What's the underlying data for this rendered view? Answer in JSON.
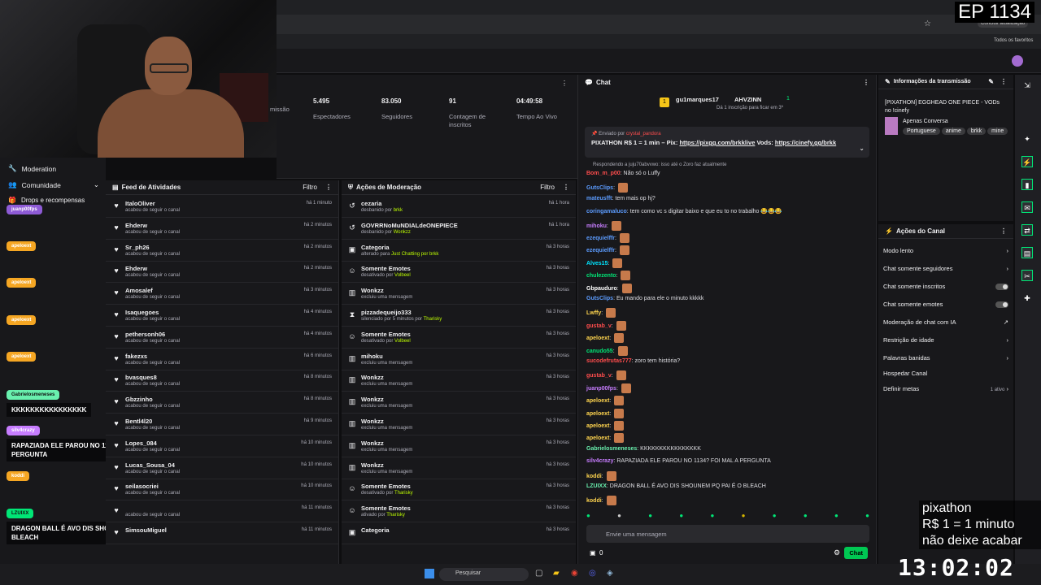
{
  "episode": "EP 1134",
  "browser": {
    "update_button": "Concluir atualização",
    "bookmarks": "Todos os favoritos"
  },
  "stats": [
    {
      "value": "",
      "label": "missão"
    },
    {
      "value": "5.495",
      "label": "Espectadores"
    },
    {
      "value": "83.050",
      "label": "Seguidores"
    },
    {
      "value": "91",
      "label": "Contagem de inscritos"
    },
    {
      "value": "04:49:58",
      "label": "Tempo Ao Vivo"
    }
  ],
  "leftnav": {
    "moderation": "Moderation",
    "community": "Comunidade",
    "drops": "Drops e recompensas"
  },
  "overlay": {
    "users": [
      "juanp00fps",
      "apeloext",
      "apeloext",
      "apeloext",
      "apeloext",
      "Gabrielosmeneses",
      "silv4crazy",
      "koddi",
      "LZUIXX"
    ],
    "msg1": "KKKKKKKKKKKKKKKK",
    "msg2": "RAPAZIADA ELE PAROU NO 1134? FOI MAL A PERGUNTA",
    "msg3": "DRAGON BALL É AVO DIS SHOUNEM PQ PAI É O BLEACH"
  },
  "feed": {
    "title": "Feed de Atividades",
    "filter": "Filtro",
    "items": [
      {
        "name": "ItaloOliver",
        "sub": "acabou de seguir o canal",
        "time": "há 1 minuto"
      },
      {
        "name": "Ehderw",
        "sub": "acabou de seguir o canal",
        "time": "há 2 minutos"
      },
      {
        "name": "Sr_ph26",
        "sub": "acabou de seguir o canal",
        "time": "há 2 minutos"
      },
      {
        "name": "Ehderw",
        "sub": "acabou de seguir o canal",
        "time": "há 2 minutos"
      },
      {
        "name": "Amosalef",
        "sub": "acabou de seguir o canal",
        "time": "há 3 minutos"
      },
      {
        "name": "Isaquegoes",
        "sub": "acabou de seguir o canal",
        "time": "há 4 minutos"
      },
      {
        "name": "pethersonh06",
        "sub": "acabou de seguir o canal",
        "time": "há 4 minutos"
      },
      {
        "name": "fakezxs",
        "sub": "acabou de seguir o canal",
        "time": "há 6 minutos"
      },
      {
        "name": "bvasques8",
        "sub": "acabou de seguir o canal",
        "time": "há 8 minutos"
      },
      {
        "name": "Gbzzinho",
        "sub": "acabou de seguir o canal",
        "time": "há 8 minutos"
      },
      {
        "name": "Bentl4l20",
        "sub": "acabou de seguir o canal",
        "time": "há 9 minutos"
      },
      {
        "name": "Lopes_084",
        "sub": "acabou de seguir o canal",
        "time": "há 10 minutos"
      },
      {
        "name": "Lucas_Sousa_04",
        "sub": "acabou de seguir o canal",
        "time": "há 10 minutos"
      },
      {
        "name": "seilasocriei",
        "sub": "acabou de seguir o canal",
        "time": "há 10 minutos"
      },
      {
        "name": "",
        "sub": "acabou de seguir o canal",
        "time": "há 11 minutos"
      },
      {
        "name": "SimsouMiguel",
        "sub": "",
        "time": "há 11 minutos"
      }
    ]
  },
  "mod": {
    "title": "Ações de Moderação",
    "filter": "Filtro",
    "items": [
      {
        "icon": "↺",
        "name": "cezaria",
        "pre": "desbanido por",
        "by": "brkk",
        "time": "há 1 hora"
      },
      {
        "icon": "↺",
        "name": "GOVRRNoMuNDIALdeONEPIECE",
        "pre": "desbanido por",
        "by": "Wonkzz",
        "time": "há 1 hora"
      },
      {
        "icon": "▣",
        "name": "Categoria",
        "pre": "alterado para",
        "by": "Just Chatting por brkk",
        "time": "há 3 horas"
      },
      {
        "icon": "☺",
        "name": "Somente Emotes",
        "pre": "desativado por",
        "by": "Volbeel",
        "time": "há 3 horas"
      },
      {
        "icon": "▥",
        "name": "Wonkzz",
        "pre": "excluiu uma mensagem",
        "by": "",
        "time": "há 3 horas"
      },
      {
        "icon": "⧗",
        "name": "pizzadequeijo333",
        "pre": "silenciado por 5 minutos por",
        "by": "Tharisky",
        "time": "há 3 horas"
      },
      {
        "icon": "☺",
        "name": "Somente Emotes",
        "pre": "desativado por",
        "by": "Volbeel",
        "time": "há 3 horas"
      },
      {
        "icon": "▥",
        "name": "mihoku",
        "pre": "excluiu uma mensagem",
        "by": "",
        "time": "há 3 horas"
      },
      {
        "icon": "▥",
        "name": "Wonkzz",
        "pre": "excluiu uma mensagem",
        "by": "",
        "time": "há 3 horas"
      },
      {
        "icon": "▥",
        "name": "Wonkzz",
        "pre": "excluiu uma mensagem",
        "by": "",
        "time": "há 3 horas"
      },
      {
        "icon": "▥",
        "name": "Wonkzz",
        "pre": "excluiu uma mensagem",
        "by": "",
        "time": "há 3 horas"
      },
      {
        "icon": "▥",
        "name": "Wonkzz",
        "pre": "excluiu uma mensagem",
        "by": "",
        "time": "há 3 horas"
      },
      {
        "icon": "▥",
        "name": "Wonkzz",
        "pre": "excluiu uma mensagem",
        "by": "",
        "time": "há 3 horas"
      },
      {
        "icon": "☺",
        "name": "Somente Emotes",
        "pre": "desativado por",
        "by": "Tharisky",
        "time": "há 3 horas"
      },
      {
        "icon": "☺",
        "name": "Somente Emotes",
        "pre": "ativado por",
        "by": "Tharisky",
        "time": "há 3 horas"
      },
      {
        "icon": "▣",
        "name": "Categoria",
        "pre": "",
        "by": "",
        "time": "há 3 horas"
      }
    ]
  },
  "chat": {
    "title": "Chat",
    "top_user": "gu1marques17",
    "top_badge": "1",
    "top_user2": "AHVZINN",
    "top_sub_line": "Dá 1 inscrição para ficar em 3º",
    "pinned_by": "Enviado por",
    "pinned_user": "crystal_pandora",
    "pinned_text": "PIXATHON R$ 1 = 1 min – Pix:",
    "pinned_link1": "https://pixgg.com/brkklive",
    "pinned_mid": "Vods:",
    "pinned_link2": "https://cinefy.gg/brkk",
    "reply_line": "Respondendo a juju70abvvwo: isso até o Zoro faz atualmente",
    "input_placeholder": "Envie uma mensagem",
    "points": "0",
    "chat_button": "Chat",
    "messages": [
      {
        "user": "Bom_m_p00",
        "color": "#ff4d4d",
        "text": "Não só o Luffy"
      },
      {
        "user": "GutsClips",
        "color": "#5c9cff",
        "text": ""
      },
      {
        "user": "mateusfft",
        "color": "#5c9cff",
        "text": "tem mais op hj?"
      },
      {
        "user": "coringamaluco",
        "color": "#5c9cff",
        "text": "tem como vc s digitar baixo e que eu to no trabalho 😂😂😂"
      },
      {
        "user": "mihoku",
        "color": "#c77dff",
        "text": ""
      },
      {
        "user": "ezequielffr",
        "color": "#5c9cff",
        "text": ""
      },
      {
        "user": "ezequielffr",
        "color": "#5c9cff",
        "text": ""
      },
      {
        "user": "Alves15",
        "color": "#00e5ff",
        "text": ""
      },
      {
        "user": "chulezento",
        "color": "#00e676",
        "text": ""
      },
      {
        "user": "Gbpauduro",
        "color": "#ffffff",
        "text": ""
      },
      {
        "user": "GutsClips",
        "color": "#5c9cff",
        "text": "Eu mando para ele o minuto kkkkk"
      },
      {
        "user": "Lwffy",
        "color": "#ffd54f",
        "text": ""
      },
      {
        "user": "gustab_v",
        "color": "#ff4d4d",
        "text": ""
      },
      {
        "user": "apeloext",
        "color": "#ffd54f",
        "text": ""
      },
      {
        "user": "canudo55",
        "color": "#00e676",
        "text": ""
      },
      {
        "user": "sucodefrutas777",
        "color": "#ff4d4d",
        "text": "zoro tem história?"
      },
      {
        "user": "gustab_v",
        "color": "#ff4d4d",
        "text": ""
      },
      {
        "user": "juanp00fps",
        "color": "#c77dff",
        "text": ""
      },
      {
        "user": "apeloext",
        "color": "#ffd54f",
        "text": ""
      },
      {
        "user": "apeloext",
        "color": "#ffd54f",
        "text": ""
      },
      {
        "user": "apeloext",
        "color": "#ffd54f",
        "text": ""
      },
      {
        "user": "apeloext",
        "color": "#ffd54f",
        "text": ""
      },
      {
        "user": "Gabrielosmeneses",
        "color": "#69f0ae",
        "text": "KKKKKKKKKKKKKKKK"
      },
      {
        "user": "silv4crazy",
        "color": "#c77dff",
        "text": "RAPAZIADA ELE PAROU NO 1134? FOI MAL A PERGUNTA"
      },
      {
        "user": "koddi",
        "color": "#ffd54f",
        "text": ""
      },
      {
        "user": "LZUIXX",
        "color": "#69f0ae",
        "text": "DRAGON BALL É AVO DIS SHOUNEM PQ PAI É O BLEACH"
      },
      {
        "user": "koddi",
        "color": "#ffd54f",
        "text": ""
      }
    ]
  },
  "info": {
    "title": "Informações da transmissão",
    "stream_title": "[PIXATHON] EGGHEAD ONE PIECE - VODs no !cinefy",
    "category": "Apenas Conversa",
    "tags": [
      "Portuguese",
      "anime",
      "brkk",
      "mine"
    ]
  },
  "actions": {
    "title": "Ações do Canal",
    "items": [
      {
        "label": "Modo lento",
        "kind": "arrow"
      },
      {
        "label": "Chat somente seguidores",
        "kind": "arrow"
      },
      {
        "label": "Chat somente inscritos",
        "kind": "toggle"
      },
      {
        "label": "Chat somente emotes",
        "kind": "toggle"
      },
      {
        "label": "Moderação de chat com IA",
        "kind": "ext"
      },
      {
        "label": "Restrição de idade",
        "kind": "arrow"
      },
      {
        "label": "Palavras banidas",
        "kind": "arrow"
      },
      {
        "label": "Hospedar Canal",
        "kind": "none"
      },
      {
        "label": "Definir metas",
        "kind": "meta"
      }
    ],
    "meta_status": "1 ativo"
  },
  "taskbar": {
    "search": "Pesquisar"
  },
  "pixathon": [
    "pixathon",
    "R$ 1 = 1 minuto",
    "não deixe acabar"
  ],
  "clock": "13:02:02",
  "colors": {
    "accent": "#00e676",
    "bg": "#18181b"
  }
}
